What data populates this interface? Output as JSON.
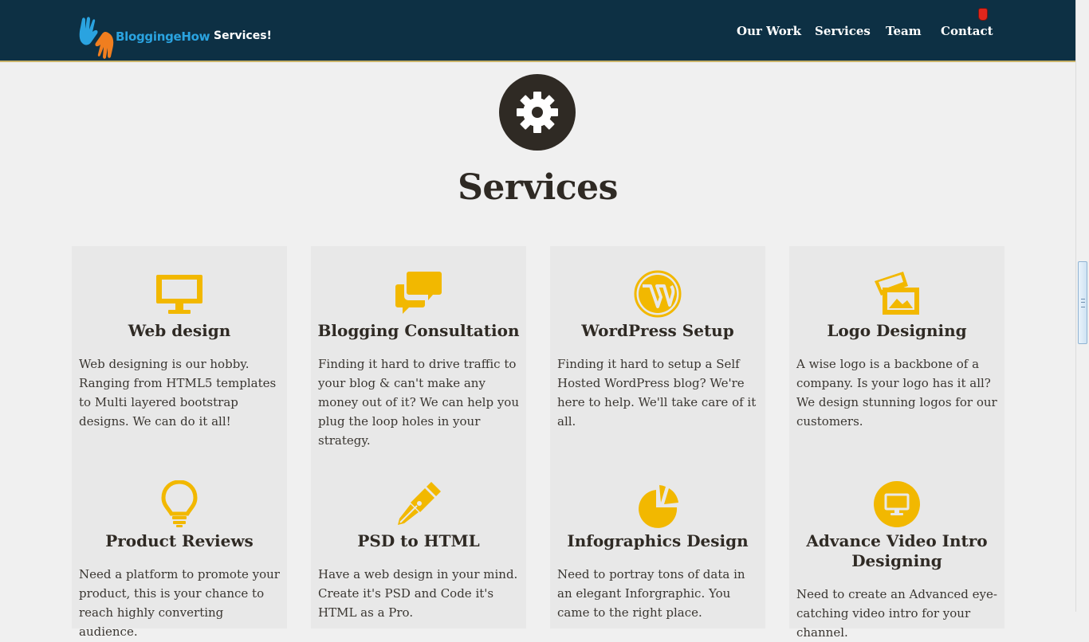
{
  "brand": {
    "name": "BloggingeHow",
    "page_label": "Services!"
  },
  "nav": {
    "items": [
      {
        "label": "Our Work"
      },
      {
        "label": "Services"
      },
      {
        "label": "Team"
      },
      {
        "label": "Contact"
      }
    ]
  },
  "colors": {
    "header_bg": "#0d3044",
    "accent": "#f2b800",
    "text_dark": "#2f2a24",
    "card_bg": "#e8e8e8",
    "page_bg": "#f0f0f0"
  },
  "hero": {
    "icon": "gear-icon",
    "title": "Services"
  },
  "services": [
    {
      "icon": "monitor-icon",
      "title": "Web design",
      "description": "Web designing is our hobby. Ranging from HTML5 templates to Multi layered bootstrap designs. We can do it all!"
    },
    {
      "icon": "chat-bubbles-icon",
      "title": "Blogging Consultation",
      "description": "Finding it hard to drive traffic to your blog & can't make any money out of it? We can help you plug the loop holes in your strategy."
    },
    {
      "icon": "wordpress-icon",
      "title": "WordPress Setup",
      "description": "Finding it hard to setup a Self Hosted WordPress blog? We're here to help. We'll take care of it all."
    },
    {
      "icon": "picture-icon",
      "title": "Logo Designing",
      "description": "A wise logo is a backbone of a company. Is your logo has it all? We design stunning logos for our customers."
    },
    {
      "icon": "lightbulb-icon",
      "title": "Product Reviews",
      "description": "Need a platform to promote your product, this is your chance to reach highly converting audience."
    },
    {
      "icon": "pen-nib-icon",
      "title": "PSD to HTML",
      "description": "Have a web design in your mind. Create it's PSD and Code it's HTML as a Pro."
    },
    {
      "icon": "pie-chart-icon",
      "title": "Infographics Design",
      "description": "Need to portray tons of data in an elegant Inforgraphic. You came to the right place."
    },
    {
      "icon": "monitor-circle-icon",
      "title": "Advance Video Intro Designing",
      "description": "Need to create an Advanced eye-catching video intro for your channel."
    }
  ]
}
